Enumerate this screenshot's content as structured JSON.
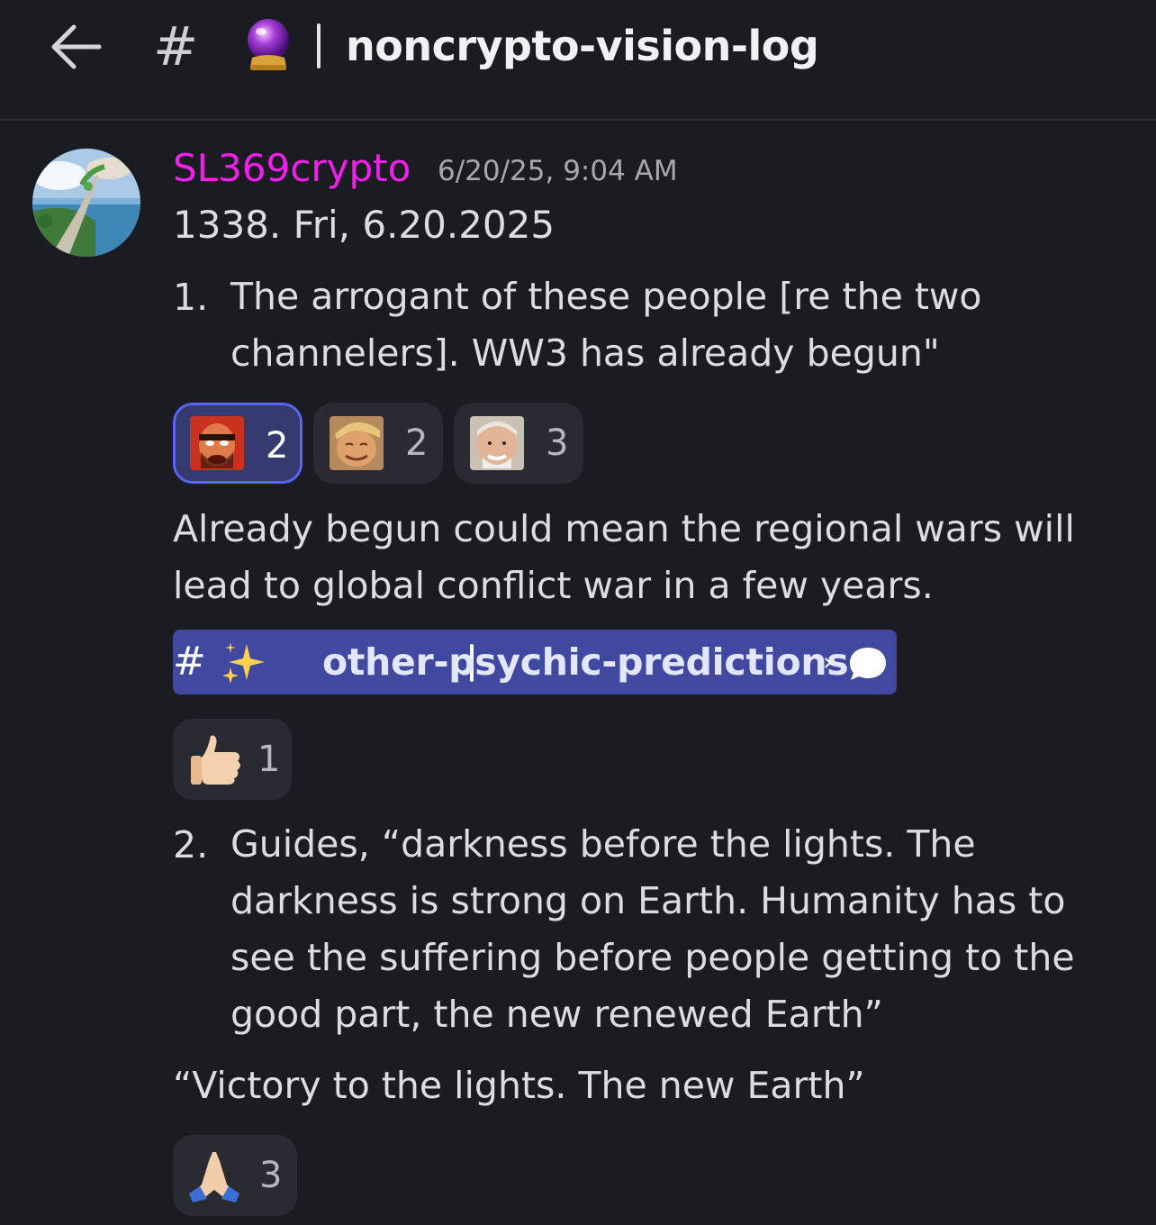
{
  "header": {
    "back_icon": "arrow-left-icon",
    "hash_symbol": "#",
    "channel_emoji": "crystal-ball-icon",
    "channel_name": "noncrypto-vision-log"
  },
  "message": {
    "author": "SL369crypto",
    "author_color": "#f21fec",
    "timestamp": "6/20/25, 9:04 AM",
    "first_line": "1338.  Fri, 6.20.2025",
    "item1_number": "1.",
    "item1_text": "The arrogant of these people [re the two channelers]. WW3 has already begun\"",
    "reactions_1": [
      {
        "emoji": "angry-man-emoji",
        "count": "2",
        "active": true
      },
      {
        "emoji": "smug-face-emoji",
        "count": "2",
        "active": false
      },
      {
        "emoji": "hide-the-pain-emoji",
        "count": "3",
        "active": false
      }
    ],
    "para1": "Already begun could mean the regional wars will lead to global conflict war in a few years.",
    "channel_link": {
      "hash": "#",
      "emoji": "sparkles-icon",
      "name": "other-psychic-predictions",
      "chevron": "›",
      "thread_icon": "speech-bubble-icon"
    },
    "reactions_2": [
      {
        "emoji": "thumbs-up-emoji",
        "count": "1"
      }
    ],
    "item2_number": "2.",
    "item2_text": "Guides, “darkness before the lights. The darkness is strong on Earth. Humanity has to see the suffering before people getting to the good part, the new renewed Earth”",
    "para2": "“Victory to the lights. The new Earth”",
    "reactions_3": [
      {
        "emoji": "folded-hands-emoji",
        "count": "3"
      }
    ]
  },
  "colors": {
    "background": "#1b1c21",
    "reaction_bg": "#2a2b32",
    "reaction_active_border": "#5865f2",
    "channel_link_bg": "#4148a0"
  }
}
